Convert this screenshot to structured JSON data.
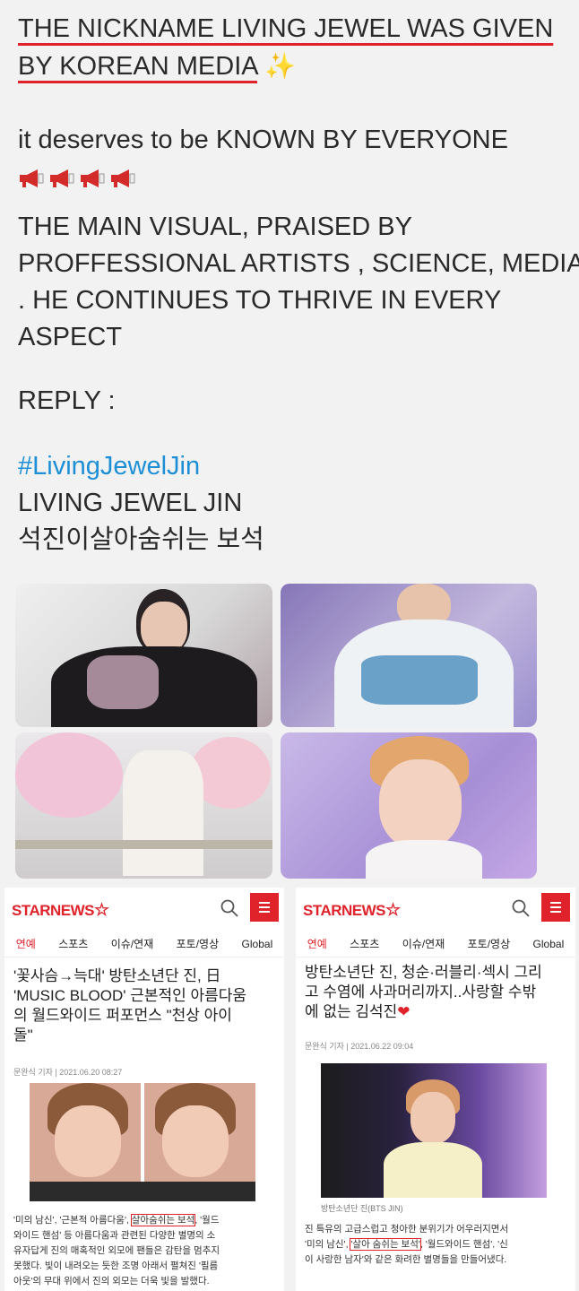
{
  "tweet": {
    "heading_line1": "THE NICKNAME LIVING JEWEL WAS GIVEN",
    "heading_line2": "BY KOREAN MEDIA",
    "sparkles_emoji": "✨",
    "deserves": "it deserves to be KNOWN BY EVERYONE",
    "megaphone_icon": "loudspeaker-icon",
    "body_lines": [
      "THE MAIN VISUAL, PRAISED BY",
      "PROFFESSIONAL ARTISTS , SCIENCE, MEDIA",
      ". HE CONTINUES TO THRIVE IN EVERY",
      "ASPECT"
    ],
    "reply": "REPLY :",
    "hashtag": "#LivingJewelJin",
    "living_jewel": "LIVING JEWEL JIN",
    "korean_line": "석진이살아숨쉬는 보석"
  },
  "colors": {
    "accent": "#e0222b",
    "hashtag": "#1d8fd6",
    "background": "#f2f2f2"
  },
  "articles": [
    {
      "brand": "STARNEWS",
      "nav": [
        "연예",
        "스포츠",
        "이슈/연재",
        "포토/영상",
        "Global"
      ],
      "headline_lines": [
        "'꽃사슴→늑대' 방탄소년단 진, 日",
        "'MUSIC BLOOD' 근본적인 아름다움",
        "의 월드와이드 퍼포먼스 \"천상 아이",
        "돌\""
      ],
      "byline": "문완식 기자 | 2021.06.20 08:27",
      "body_lines": [
        "'미의 남신', '근본적 아름다움', ",
        "살아숨쉬는 보석",
        ", '월드",
        "와이드 핸섬' 등 아름다움과 관련된 다양한 별명의 소",
        "유자답게 진의 매혹적인 외모에 팬들은 감탄을 멈추지",
        "못했다. 빛이 내려오는 듯한 조명 아래서 펼쳐진 '필름",
        "아웃'의 무대 위에서 진의 외모는 더욱 빛을 발했다."
      ]
    },
    {
      "brand": "STARNEWS",
      "nav": [
        "연예",
        "스포츠",
        "이슈/연재",
        "포토/영상",
        "Global"
      ],
      "headline_lines": [
        "방탄소년단 진, 청순·러블리·섹시 그리",
        "고 수염에 사과머리까지..사랑할 수밖",
        "에 없는 김석진"
      ],
      "heart": "❤",
      "byline": "문완식 기자 | 2021.06.22 09:04",
      "caption": "방탄소년단 진(BTS JIN)",
      "body_lines": [
        "진 특유의 고급스럽고 청아한 분위기가 어우러지면서",
        "'미의 남신', ",
        "'살아 숨쉬는 보석'",
        ", '월드와이드 핸섬', '신",
        "이 사랑한 남자'와 같은 화려한 별명들을 만들어냈다."
      ]
    }
  ]
}
